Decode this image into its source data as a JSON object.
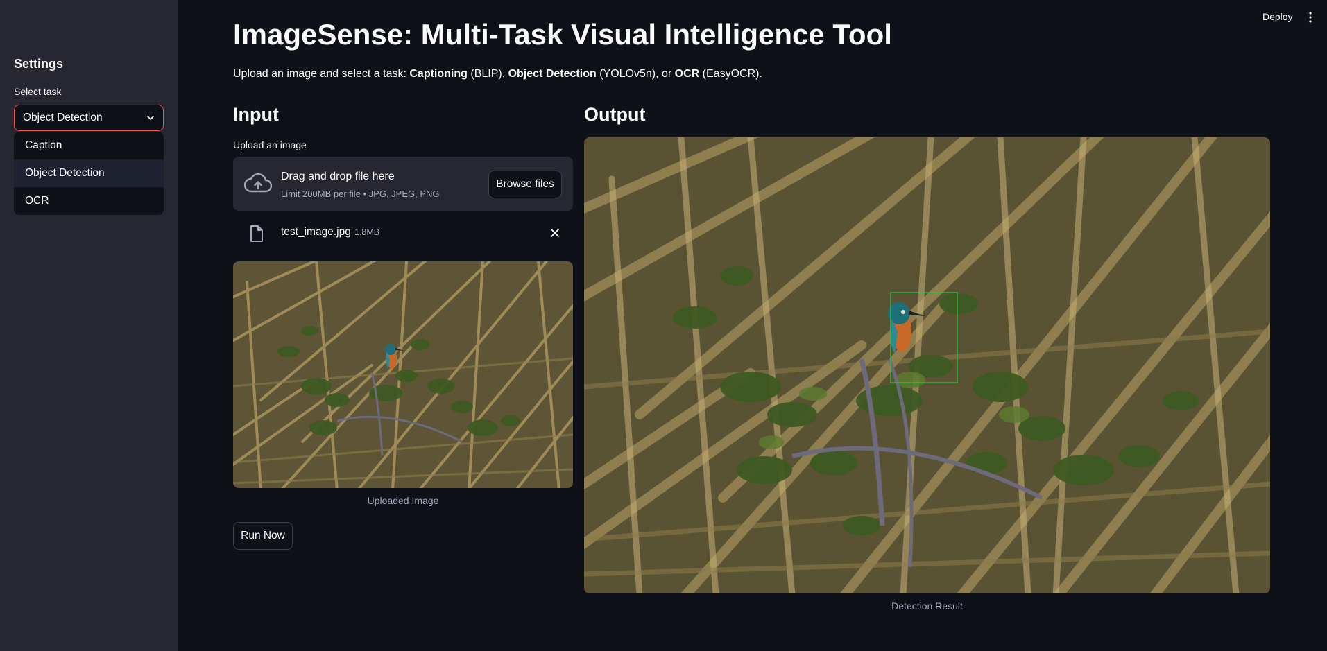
{
  "header": {
    "deploy_label": "Deploy",
    "menu_icon": "kebab-menu-icon"
  },
  "sidebar": {
    "heading": "Settings",
    "select_label": "Select task",
    "selected": "Object Detection",
    "options": [
      "Caption",
      "Object Detection",
      "OCR"
    ]
  },
  "main": {
    "title": "ImageSense: Multi-Task Visual Intelligence Tool",
    "intro": {
      "prefix": "Upload an image and select a task: ",
      "t1": "Captioning",
      "t1_suffix": " (BLIP), ",
      "t2": "Object Detection",
      "t2_suffix": " (YOLOv5n), or ",
      "t3": "OCR",
      "t3_suffix": " (EasyOCR)."
    },
    "input": {
      "heading": "Input",
      "upload_label": "Upload an image",
      "dropzone_main": "Drag and drop file here",
      "dropzone_sub": "Limit 200MB per file • JPG, JPEG, PNG",
      "browse_label": "Browse files",
      "file_name": "test_image.jpg",
      "file_size": "1.8MB",
      "image_caption": "Uploaded Image",
      "run_label": "Run Now"
    },
    "output": {
      "heading": "Output",
      "image_caption": "Detection Result"
    }
  },
  "colors": {
    "accent": "#ff4b4b",
    "background": "#0e1117",
    "sidebar": "#262730",
    "detection_box": "#2ecc40"
  }
}
